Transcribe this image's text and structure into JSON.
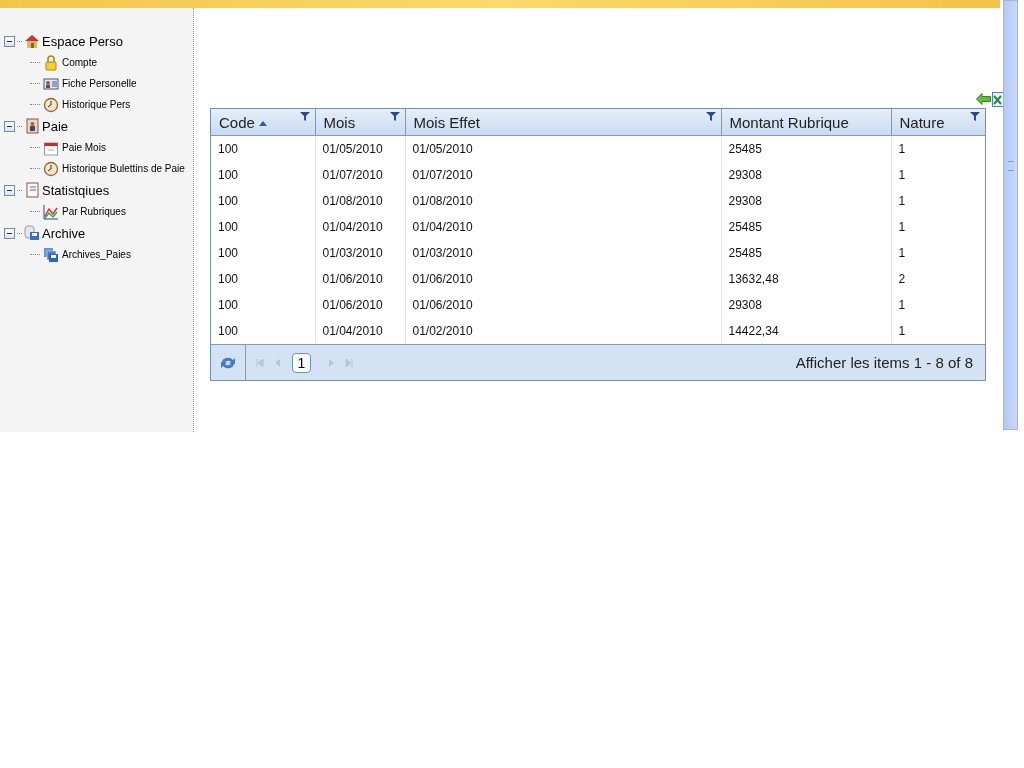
{
  "tree": [
    {
      "label": "Espace Perso",
      "expanded": true,
      "children": [
        {
          "label": "Compte"
        },
        {
          "label": "Fiche Personelle"
        },
        {
          "label": "Historique Pers"
        }
      ]
    },
    {
      "label": "Paie",
      "expanded": true,
      "children": [
        {
          "label": "Paie Mois"
        },
        {
          "label": "Historique Bulettins de Paie"
        }
      ]
    },
    {
      "label": "Statistqiues",
      "expanded": true,
      "children": [
        {
          "label": "Par Rubriques"
        }
      ]
    },
    {
      "label": "Archive",
      "expanded": true,
      "children": [
        {
          "label": "Archives_Paies"
        }
      ]
    }
  ],
  "table": {
    "columns": [
      {
        "label": "Code",
        "sorted": true,
        "filterable": true
      },
      {
        "label": "Mois",
        "sorted": false,
        "filterable": true
      },
      {
        "label": "Mois Effet",
        "sorted": false,
        "filterable": true
      },
      {
        "label": "Montant Rubrique",
        "sorted": false,
        "filterable": false
      },
      {
        "label": "Nature",
        "sorted": false,
        "filterable": true
      }
    ],
    "rows": [
      [
        "100",
        "01/05/2010",
        "01/05/2010",
        "25485",
        "1"
      ],
      [
        "100",
        "01/07/2010",
        "01/07/2010",
        "29308",
        "1"
      ],
      [
        "100",
        "01/08/2010",
        "01/08/2010",
        "29308",
        "1"
      ],
      [
        "100",
        "01/04/2010",
        "01/04/2010",
        "25485",
        "1"
      ],
      [
        "100",
        "01/03/2010",
        "01/03/2010",
        "25485",
        "1"
      ],
      [
        "100",
        "01/06/2010",
        "01/06/2010",
        "13632,48",
        "2"
      ],
      [
        "100",
        "01/06/2010",
        "01/06/2010",
        "29308",
        "1"
      ],
      [
        "100",
        "01/04/2010",
        "01/02/2010",
        "14422,34",
        "1"
      ]
    ]
  },
  "pager": {
    "pages": [
      {
        "label": "1",
        "selected": true
      }
    ],
    "summary": "Afficher les items 1 - 8 of 8"
  }
}
